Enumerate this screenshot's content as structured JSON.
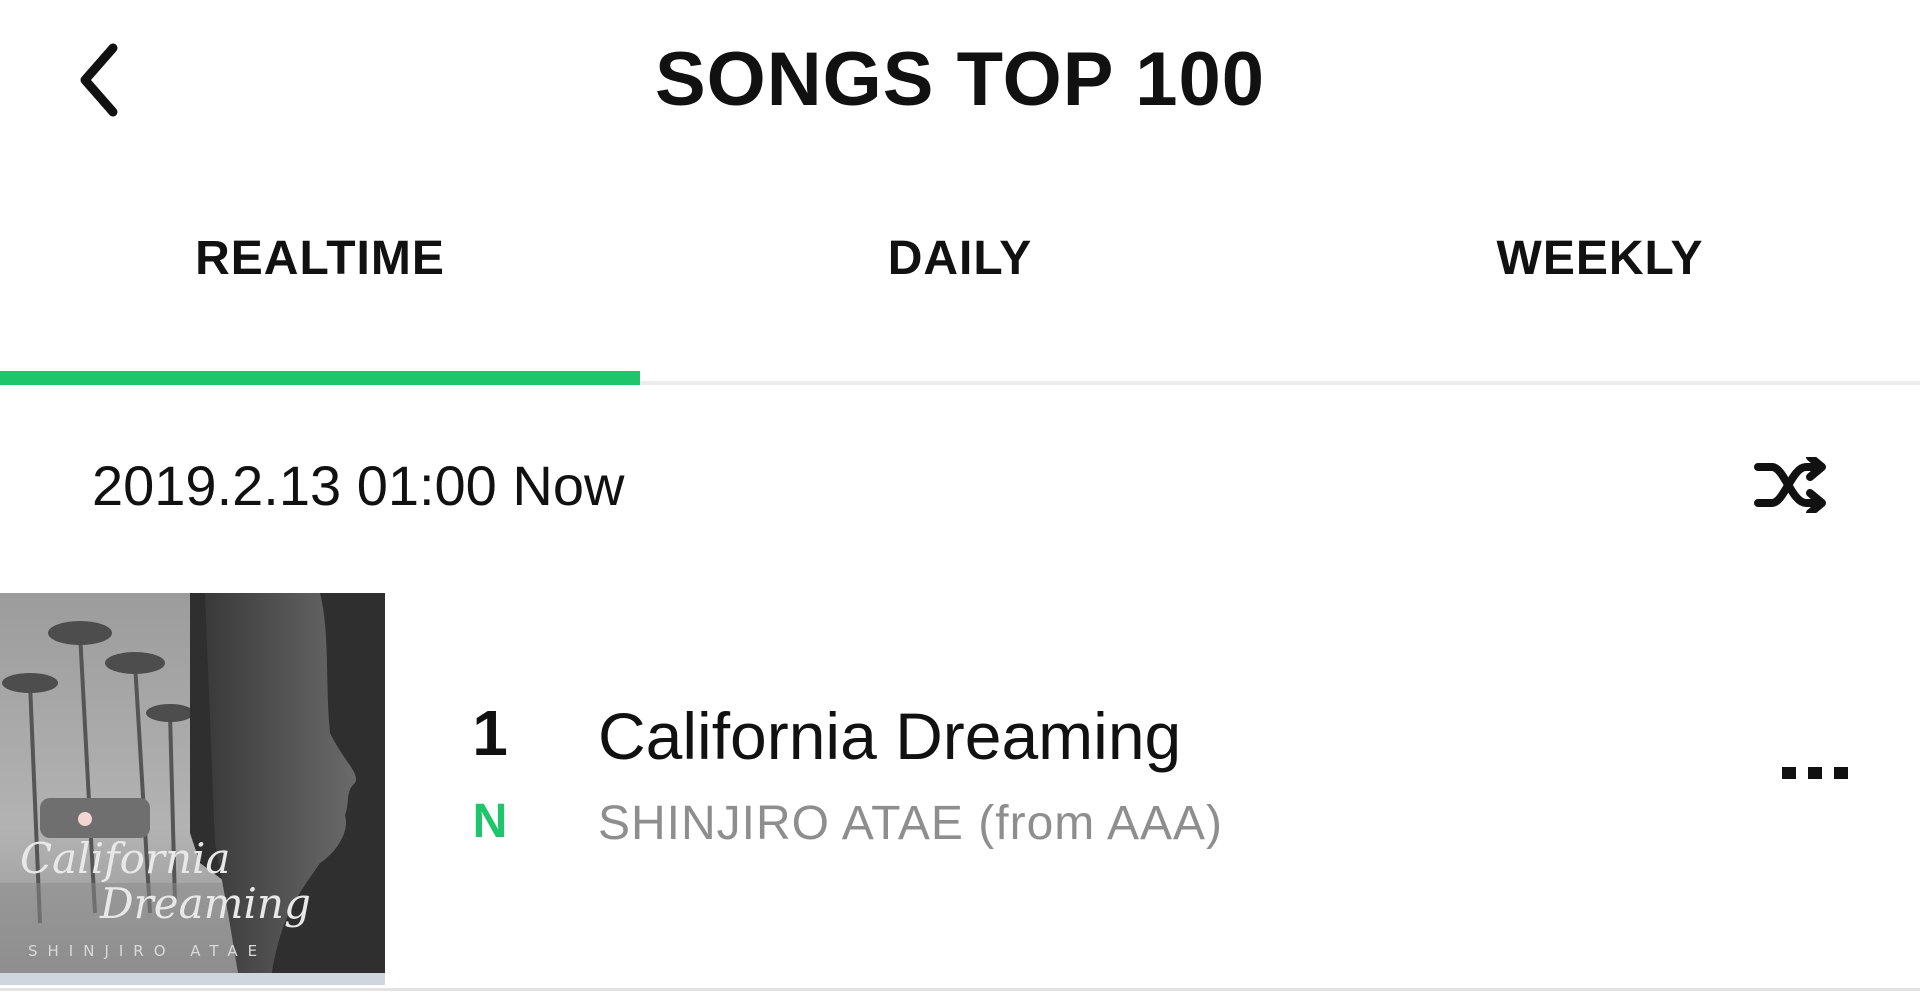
{
  "header": {
    "title": "SONGS TOP 100",
    "back_icon": "chevron-left-icon"
  },
  "tabs": [
    {
      "label": "REALTIME",
      "selected": true
    },
    {
      "label": "DAILY",
      "selected": false
    },
    {
      "label": "WEEKLY",
      "selected": false
    }
  ],
  "colors": {
    "accent": "#1fc56a",
    "active_tab_underline": "#1fc56a",
    "artist_text": "#8e8e8e"
  },
  "chart_info": {
    "timestamp": "2019.2.13 01:00 Now",
    "shuffle_icon": "shuffle-icon"
  },
  "songs": [
    {
      "rank": "1",
      "change_badge": "N",
      "title": "California Dreaming",
      "artist": "SHINJIRO ATAE (from AAA)",
      "album_art_text": {
        "line1": "California",
        "line2": "Dreaming",
        "line3": "SHINJIRO ATAE"
      },
      "more_icon": "more-horizontal-icon"
    }
  ]
}
